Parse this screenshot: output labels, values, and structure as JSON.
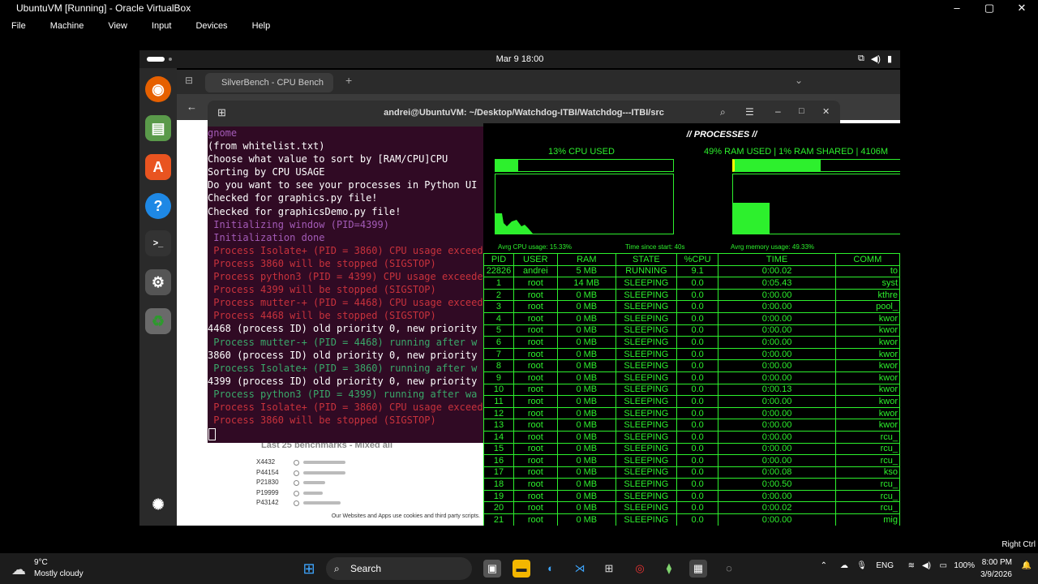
{
  "vbox": {
    "title": "UbuntuVM [Running] - Oracle VirtualBox",
    "menu": [
      "File",
      "Machine",
      "View",
      "Input",
      "Devices",
      "Help"
    ],
    "status": "Right Ctrl"
  },
  "ubuntu": {
    "clock": "Mar 9  18:00"
  },
  "browser": {
    "tab_title": "SilverBench - CPU Bench",
    "bench_heading": "Last 25 benchmarks - Mixed all",
    "bench_rows": [
      {
        "name": "X4432",
        "score": 0.55
      },
      {
        "name": "P44154",
        "score": 0.55
      },
      {
        "name": "P21830",
        "score": 0.28
      },
      {
        "name": "P19999",
        "score": 0.25
      },
      {
        "name": "P43142",
        "score": 0.48
      }
    ],
    "cookie_text": "Our Websites and Apps use cookies and third party scripts."
  },
  "terminal": {
    "title": "andrei@UbuntuVM: ~/Desktop/Watchdog-ITBI/Watchdog---ITBI/src",
    "lines": [
      {
        "t": "gnome",
        "c": "purple"
      },
      {
        "t": "(from whitelist.txt)",
        "c": "white"
      },
      {
        "t": "Choose what value to sort by [RAM/CPU]CPU",
        "c": "white"
      },
      {
        "t": "Sorting by CPU USAGE",
        "c": "white"
      },
      {
        "t": "Do you want to see your processes in Python UI",
        "c": "white"
      },
      {
        "t": "Checked for graphics.py file!",
        "c": "white"
      },
      {
        "t": "Checked for graphicsDemo.py file!",
        "c": "white"
      },
      {
        "t": " Initializing window (PID=4399)",
        "c": "purple"
      },
      {
        "t": " Initialization done",
        "c": "purple"
      },
      {
        "t": " Process Isolate+ (PID = 3860) CPU usage exceed",
        "c": "red"
      },
      {
        "t": " Process 3860 will be stopped (SIGSTOP)",
        "c": "red"
      },
      {
        "t": " Process python3 (PID = 4399) CPU usage exceede",
        "c": "red"
      },
      {
        "t": " Process 4399 will be stopped (SIGSTOP)",
        "c": "red"
      },
      {
        "t": " Process mutter-+ (PID = 4468) CPU usage exceed",
        "c": "red"
      },
      {
        "t": " Process 4468 will be stopped (SIGSTOP)",
        "c": "red"
      },
      {
        "t": "4468 (process ID) old priority 0, new priority",
        "c": "white"
      },
      {
        "t": " Process mutter-+ (PID = 4468) running after w",
        "c": "green"
      },
      {
        "t": "3860 (process ID) old priority 0, new priority",
        "c": "white"
      },
      {
        "t": " Process Isolate+ (PID = 3860) running after w",
        "c": "green"
      },
      {
        "t": "4399 (process ID) old priority 0, new priority",
        "c": "white"
      },
      {
        "t": " Process python3 (PID = 4399) running after wa",
        "c": "green"
      },
      {
        "t": " Process Isolate+ (PID = 3860) CPU usage exceed",
        "c": "red"
      },
      {
        "t": " Process 3860 will be stopped (SIGSTOP)",
        "c": "red"
      }
    ]
  },
  "processes": {
    "title": "// PROCESSES //",
    "cpu_label": "13% CPU USED",
    "cpu_fraction": 0.13,
    "ram_label": "49% RAM USED | 1% RAM SHARED | 4106M",
    "ram_fraction": 0.49,
    "avg_cpu": "Avrg CPU usage: 15.33%",
    "time_since": "Time since start: 40s",
    "avg_mem": "Avrg memory usage: 49.33%",
    "headers": [
      "PID",
      "USER",
      "RAM",
      "STATE",
      "%CPU",
      "TIME",
      "COMM"
    ],
    "rows": [
      [
        "22826",
        "andrei",
        "5 MB",
        "RUNNING",
        "9.1",
        "0:00.02",
        "to"
      ],
      [
        "1",
        "root",
        "14 MB",
        "SLEEPING",
        "0.0",
        "0:05.43",
        "syst"
      ],
      [
        "2",
        "root",
        "0 MB",
        "SLEEPING",
        "0.0",
        "0:00.00",
        "kthre"
      ],
      [
        "3",
        "root",
        "0 MB",
        "SLEEPING",
        "0.0",
        "0:00.00",
        "pool_"
      ],
      [
        "4",
        "root",
        "0 MB",
        "SLEEPING",
        "0.0",
        "0:00.00",
        "kwor"
      ],
      [
        "5",
        "root",
        "0 MB",
        "SLEEPING",
        "0.0",
        "0:00.00",
        "kwor"
      ],
      [
        "6",
        "root",
        "0 MB",
        "SLEEPING",
        "0.0",
        "0:00.00",
        "kwor"
      ],
      [
        "7",
        "root",
        "0 MB",
        "SLEEPING",
        "0.0",
        "0:00.00",
        "kwor"
      ],
      [
        "8",
        "root",
        "0 MB",
        "SLEEPING",
        "0.0",
        "0:00.00",
        "kwor"
      ],
      [
        "9",
        "root",
        "0 MB",
        "SLEEPING",
        "0.0",
        "0:00.00",
        "kwor"
      ],
      [
        "10",
        "root",
        "0 MB",
        "SLEEPING",
        "0.0",
        "0:00.13",
        "kwor"
      ],
      [
        "11",
        "root",
        "0 MB",
        "SLEEPING",
        "0.0",
        "0:00.00",
        "kwor"
      ],
      [
        "12",
        "root",
        "0 MB",
        "SLEEPING",
        "0.0",
        "0:00.00",
        "kwor"
      ],
      [
        "13",
        "root",
        "0 MB",
        "SLEEPING",
        "0.0",
        "0:00.00",
        "kwor"
      ],
      [
        "14",
        "root",
        "0 MB",
        "SLEEPING",
        "0.0",
        "0:00.00",
        "rcu_"
      ],
      [
        "15",
        "root",
        "0 MB",
        "SLEEPING",
        "0.0",
        "0:00.00",
        "rcu_"
      ],
      [
        "16",
        "root",
        "0 MB",
        "SLEEPING",
        "0.0",
        "0:00.00",
        "rcu_"
      ],
      [
        "17",
        "root",
        "0 MB",
        "SLEEPING",
        "0.0",
        "0:00.08",
        "kso"
      ],
      [
        "18",
        "root",
        "0 MB",
        "SLEEPING",
        "0.0",
        "0:00.50",
        "rcu_"
      ],
      [
        "19",
        "root",
        "0 MB",
        "SLEEPING",
        "0.0",
        "0:00.00",
        "rcu_"
      ],
      [
        "20",
        "root",
        "0 MB",
        "SLEEPING",
        "0.0",
        "0:00.02",
        "rcu_"
      ],
      [
        "21",
        "root",
        "0 MB",
        "SLEEPING",
        "0.0",
        "0:00.00",
        "mig"
      ]
    ]
  },
  "windows_taskbar": {
    "temp": "9°C",
    "weather": "Mostly cloudy",
    "search": "Search",
    "lang": "ENG",
    "battery": "100%",
    "time": "8:00 PM",
    "date": "3/9/2026"
  },
  "colors": {
    "terminal_bg": "#300a24",
    "matrix_green": "#2df02d"
  }
}
